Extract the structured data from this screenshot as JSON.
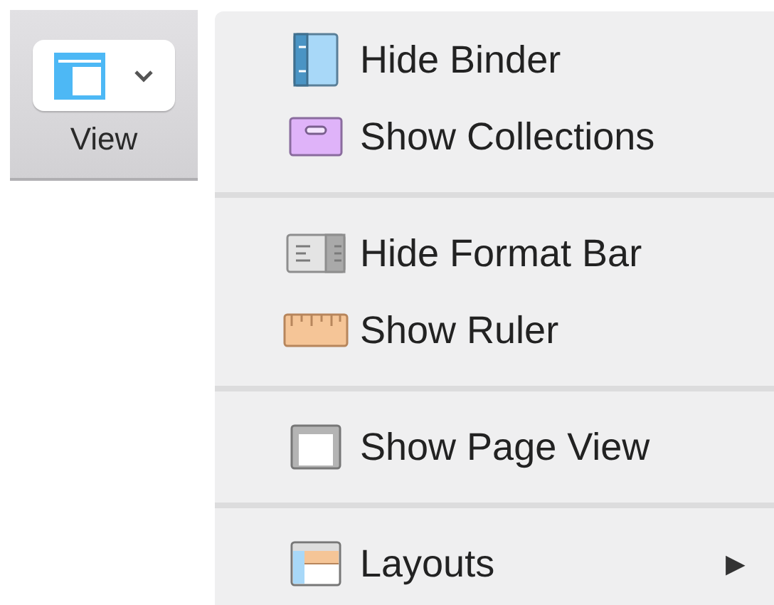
{
  "toolbar": {
    "button": {
      "label": "View"
    }
  },
  "menu": {
    "groups": [
      {
        "items": [
          {
            "label": "Hide Binder",
            "kind": "binder"
          },
          {
            "label": "Show Collections",
            "kind": "collections"
          }
        ]
      },
      {
        "items": [
          {
            "label": "Hide Format Bar",
            "kind": "format-bar"
          },
          {
            "label": "Show Ruler",
            "kind": "ruler"
          }
        ]
      },
      {
        "items": [
          {
            "label": "Show Page View",
            "kind": "page-view"
          }
        ]
      },
      {
        "items": [
          {
            "label": "Layouts",
            "kind": "layouts",
            "submenu_arrow": "▶"
          }
        ]
      }
    ]
  }
}
